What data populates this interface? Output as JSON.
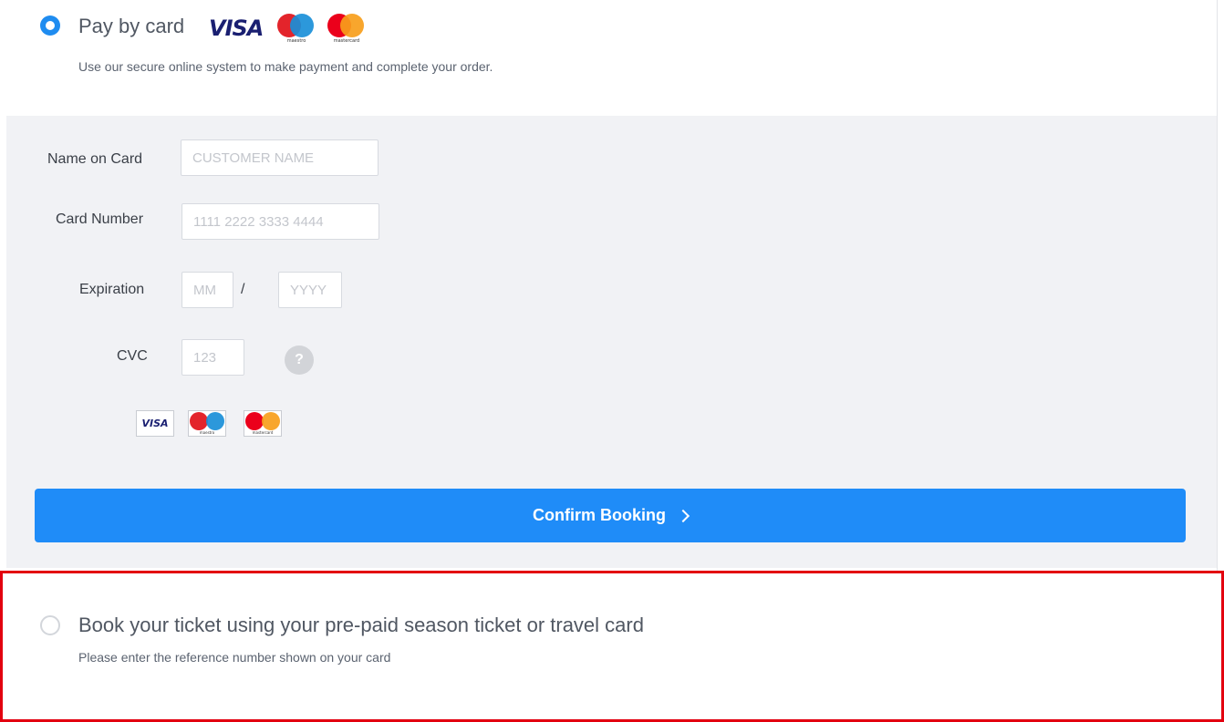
{
  "payment": {
    "pay_by_card": {
      "label": "Pay by card",
      "selected": true,
      "logos": {
        "visa": "VISA",
        "maestro_caption": "maestro",
        "mastercard_caption": "mastercard"
      },
      "description": "Use our secure online system to make payment and complete your order."
    },
    "form": {
      "name": {
        "label": "Name on Card",
        "placeholder": "CUSTOMER NAME",
        "value": ""
      },
      "number": {
        "label": "Card Number",
        "placeholder": "1111 2222 3333 4444",
        "value": ""
      },
      "expiration": {
        "label": "Expiration",
        "month_placeholder": "MM",
        "separator": "/",
        "year_placeholder": "YYYY"
      },
      "cvc": {
        "label": "CVC",
        "placeholder": "123",
        "help": "?"
      },
      "accepted_cards": {
        "visa": "VISA",
        "maestro": "maestro",
        "mastercard": "mastercard"
      }
    },
    "confirm_button": {
      "label": "Confirm Booking"
    },
    "season_ticket": {
      "label": "Book your ticket using your pre-paid season ticket or travel card",
      "description": "Please enter the reference number shown on your card",
      "selected": false
    }
  },
  "colors": {
    "accent": "#1f8cf8",
    "highlight_border": "#e3000f",
    "panel_background": "#f1f2f5"
  }
}
